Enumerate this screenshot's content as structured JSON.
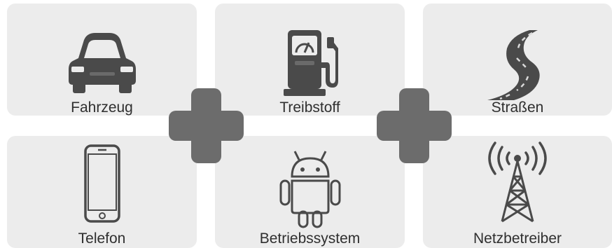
{
  "colors": {
    "tile_background": "#ececec",
    "icon_fill": "#4a4a4a",
    "plus_fill": "#6c6c6c",
    "label_text": "#2f2f2f"
  },
  "tiles": [
    {
      "label": "Fahrzeug",
      "icon": "car-icon"
    },
    {
      "label": "Treibstoff",
      "icon": "fuel-pump-icon"
    },
    {
      "label": "Straßen",
      "icon": "road-icon"
    },
    {
      "label": "Telefon",
      "icon": "smartphone-icon"
    },
    {
      "label": "Betriebssystem",
      "icon": "android-icon"
    },
    {
      "label": "Netzbetreiber",
      "icon": "cell-tower-icon"
    }
  ],
  "operators": [
    {
      "icon": "plus-icon"
    },
    {
      "icon": "plus-icon"
    }
  ]
}
